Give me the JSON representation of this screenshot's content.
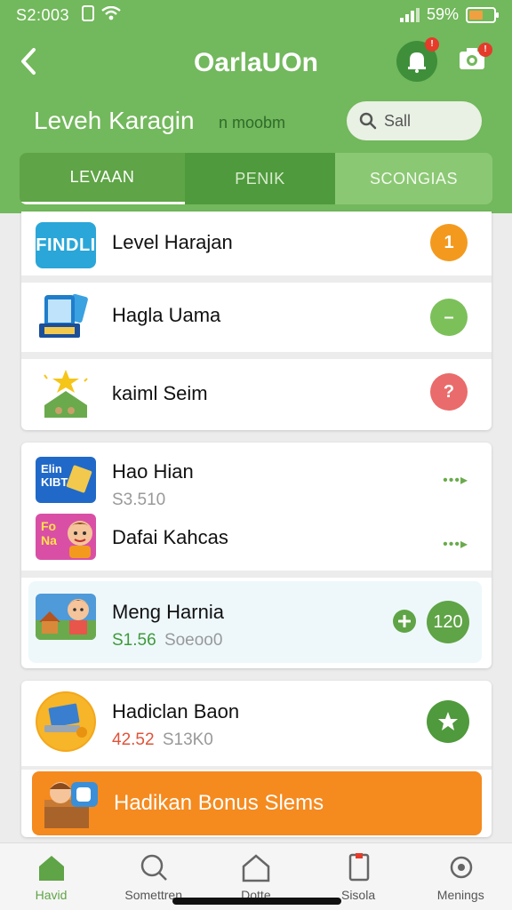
{
  "status_bar": {
    "time": "S2:003",
    "battery": "59%",
    "battery_level": 0.59
  },
  "header": {
    "title": "OarlaUOn",
    "level_title": "Leveh Karagin",
    "level_sub": "n moobm",
    "search_placeholder": "Sall"
  },
  "tabs": [
    "LEVAAN",
    "PENIK",
    "SCONGIAS"
  ],
  "list1": [
    {
      "title": "Level Harajan",
      "icon_text": "FINDLI",
      "action": "1",
      "action_color": "#f39a1e"
    },
    {
      "title": "Hagla Uama",
      "icon_text": "",
      "action": "–",
      "action_color": "#7cc05a"
    },
    {
      "title": "kaiml Seim",
      "icon_text": "",
      "action": "?",
      "action_color": "#ea6b6b"
    }
  ],
  "list2": [
    {
      "title": "Hao Hian",
      "sub": "S3.510",
      "icon_text": "Elin KIBT",
      "dots": "•••▸"
    },
    {
      "title": "Dafai Kahcas",
      "icon_text": "Fo Na",
      "dots": "•••▸"
    }
  ],
  "item3": {
    "title": "Meng Harnia",
    "price": "S1.56",
    "sub2": "Soeoo0",
    "badge": "120"
  },
  "item4": {
    "title": "Hadiclan Baon",
    "price": "42.52",
    "sub2": "S13K0"
  },
  "promo": {
    "text": "Hadikan Bonus Slems"
  },
  "nav": [
    "Havid",
    "Somettren",
    "Dotte",
    "Sisola",
    "Menings"
  ]
}
